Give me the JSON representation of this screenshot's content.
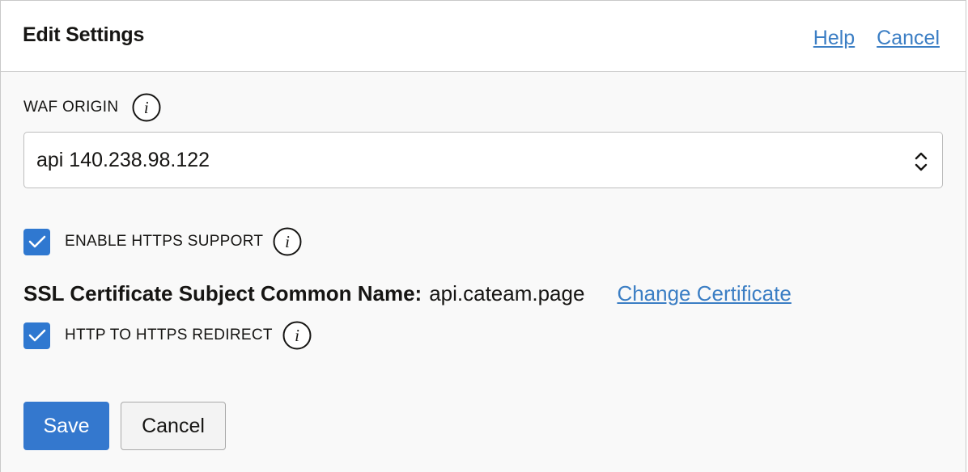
{
  "header": {
    "title": "Edit Settings",
    "help_link": "Help",
    "cancel_link": "Cancel"
  },
  "waf_origin": {
    "label": "WAF ORIGIN",
    "info_icon": "info-icon",
    "selected_value": "api 140.238.98.122"
  },
  "https_support": {
    "label": "ENABLE HTTPS SUPPORT",
    "checked": true,
    "info_icon": "info-icon"
  },
  "ssl_certificate": {
    "label": "SSL Certificate Subject Common Name:",
    "value": "api.cateam.page",
    "change_link": "Change Certificate"
  },
  "https_redirect": {
    "label": "HTTP TO HTTPS REDIRECT",
    "checked": true,
    "info_icon": "info-icon"
  },
  "footer": {
    "save_label": "Save",
    "cancel_label": "Cancel"
  },
  "colors": {
    "accent": "#3478ce",
    "link": "#3b7ec4",
    "checkbox": "#2f78d0"
  }
}
